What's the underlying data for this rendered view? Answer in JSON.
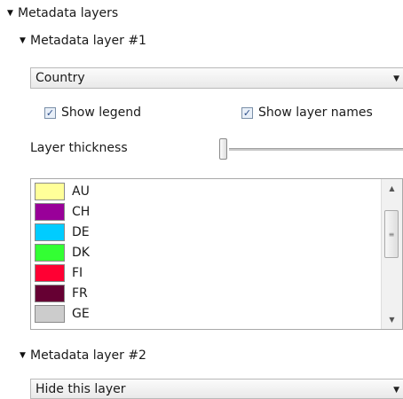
{
  "panel": {
    "section_title": "Metadata layers",
    "layer1": {
      "title": "Metadata layer #1",
      "selected": "Country",
      "show_legend_label": "Show legend",
      "show_legend_checked": true,
      "show_names_label": "Show layer names",
      "show_names_checked": true,
      "thickness_label": "Layer thickness",
      "thickness_value": 0.0,
      "items": [
        {
          "label": "AU",
          "color": "#ffff99"
        },
        {
          "label": "CH",
          "color": "#990099"
        },
        {
          "label": "DE",
          "color": "#00ccff"
        },
        {
          "label": "DK",
          "color": "#33ff33"
        },
        {
          "label": "FI",
          "color": "#ff0033"
        },
        {
          "label": "FR",
          "color": "#660033"
        },
        {
          "label": "GE",
          "color": "#cccccc"
        }
      ]
    },
    "layer2": {
      "title": "Metadata layer #2",
      "selected": "Hide this layer"
    }
  },
  "icons": {
    "expand": "triangle-down-icon",
    "dropdown": "chevron-down-icon",
    "check": "checkmark-icon",
    "scroll_up": "arrow-up-icon",
    "scroll_down": "arrow-down-icon"
  }
}
